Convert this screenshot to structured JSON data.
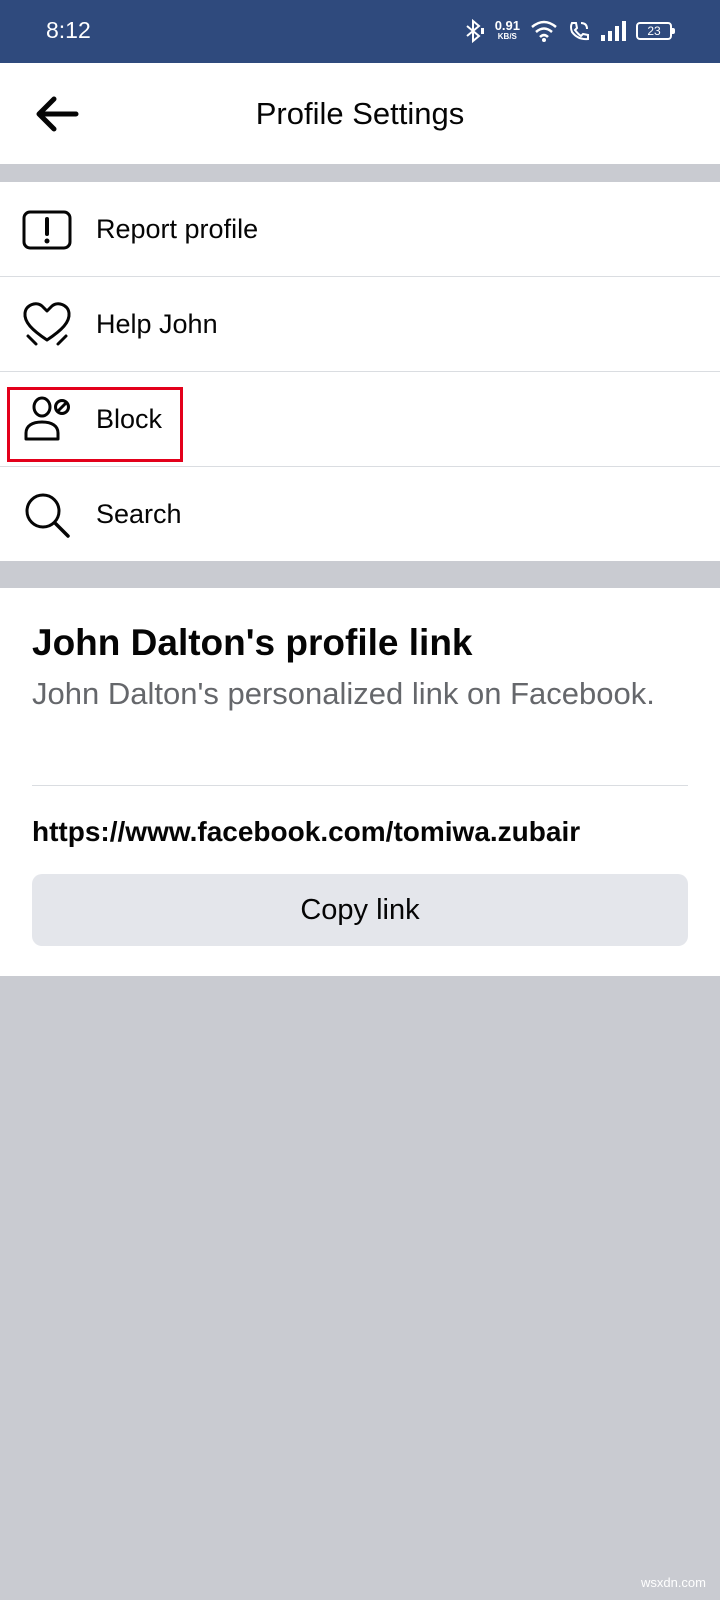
{
  "status_bar": {
    "time": "8:12",
    "net_speed": "0.91",
    "net_unit": "KB/S",
    "battery": "23",
    "icons": [
      "bluetooth-icon",
      "wifi-icon",
      "wifi-call-icon",
      "signal-icon",
      "battery-icon"
    ]
  },
  "header": {
    "title": "Profile Settings",
    "back_icon": "arrow-left-icon"
  },
  "menu": {
    "items": [
      {
        "label": "Report profile",
        "icon": "report-icon"
      },
      {
        "label": "Help John",
        "icon": "heart-hand-icon"
      },
      {
        "label": "Block",
        "icon": "block-user-icon"
      },
      {
        "label": "Search",
        "icon": "search-icon"
      }
    ],
    "highlight_color": "#e3001b"
  },
  "profile_link": {
    "heading": "John Dalton's profile link",
    "description": "John Dalton's personalized link on Facebook.",
    "url": "https://www.facebook.com/tomiwa.zubair",
    "copy_label": "Copy link"
  },
  "watermark": "wsxdn.com",
  "colors": {
    "status_bar": "#2f4a7d",
    "page_bg": "#c9cbd1",
    "button_bg": "#e4e6eb",
    "secondary_text": "#65676b"
  }
}
